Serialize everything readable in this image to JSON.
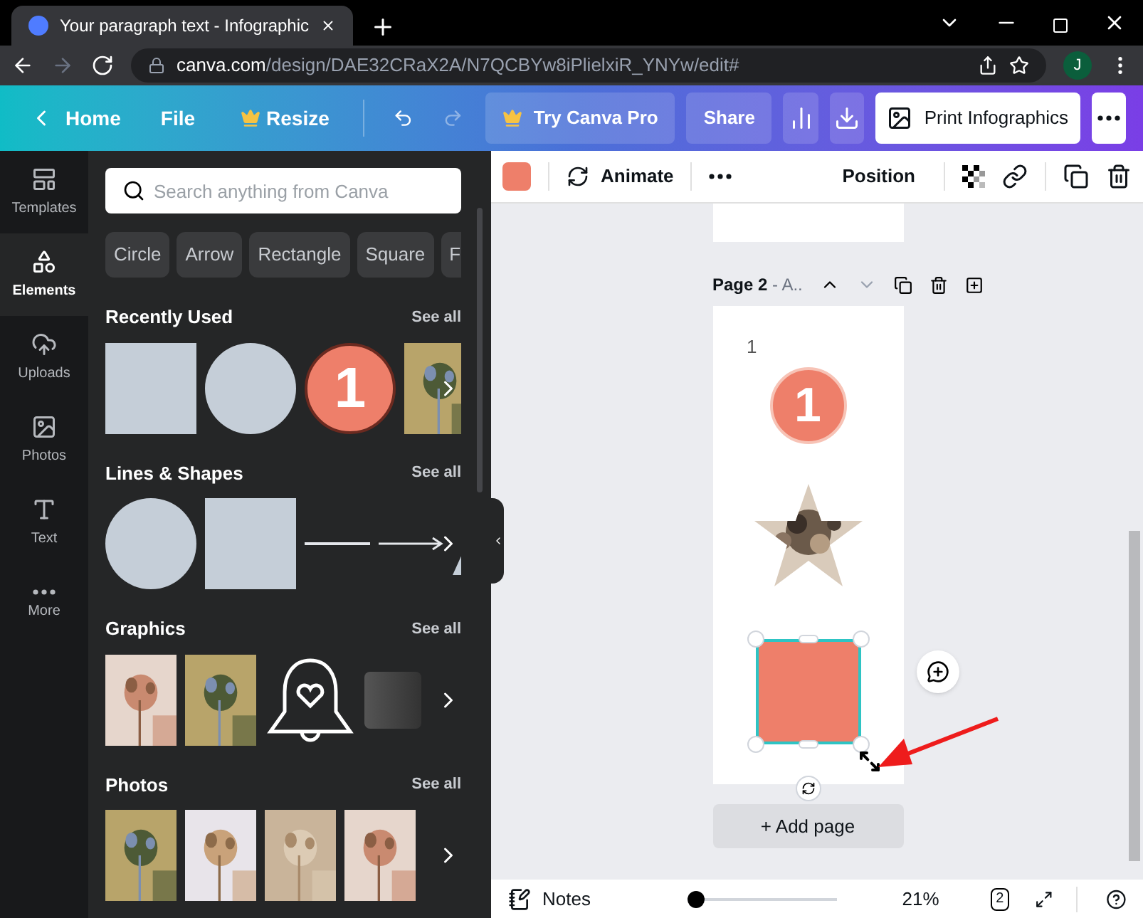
{
  "browser": {
    "tab_title": "Your paragraph text - Infographic",
    "url_host": "canva.com",
    "url_path": "/design/DAE32CRaX2A/N7QCBYw8iPlielxiR_YNYw/edit#",
    "profile_initial": "J"
  },
  "toolbar": {
    "home": "Home",
    "file": "File",
    "resize": "Resize",
    "try_pro": "Try Canva Pro",
    "share": "Share",
    "print": "Print Infographics"
  },
  "rail": [
    {
      "label": "Templates",
      "selected": false
    },
    {
      "label": "Elements",
      "selected": true
    },
    {
      "label": "Uploads",
      "selected": false
    },
    {
      "label": "Photos",
      "selected": false
    },
    {
      "label": "Text",
      "selected": false
    },
    {
      "label": "More",
      "selected": false
    }
  ],
  "search": {
    "placeholder": "Search anything from Canva"
  },
  "chips": [
    "Circle",
    "Arrow",
    "Rectangle",
    "Square",
    "F"
  ],
  "sections": [
    {
      "title": "Recently Used",
      "see_all": "See all",
      "items": [
        {
          "kind": "square"
        },
        {
          "kind": "circle"
        },
        {
          "kind": "badge",
          "text": "1"
        },
        {
          "kind": "picture"
        }
      ]
    },
    {
      "title": "Lines & Shapes",
      "see_all": "See all",
      "items": [
        {
          "kind": "circle"
        },
        {
          "kind": "square"
        },
        {
          "kind": "line"
        },
        {
          "kind": "arrow"
        },
        {
          "kind": "cone"
        }
      ]
    },
    {
      "title": "Graphics",
      "see_all": "See all",
      "items": [
        {
          "kind": "picture"
        },
        {
          "kind": "picture"
        },
        {
          "kind": "bell"
        },
        {
          "kind": "gray"
        }
      ]
    },
    {
      "title": "Photos",
      "see_all": "See all",
      "items": [
        {
          "kind": "picture"
        },
        {
          "kind": "picture"
        },
        {
          "kind": "picture"
        },
        {
          "kind": "picture"
        }
      ]
    }
  ],
  "edit_bar": {
    "color": "#ee7f6a",
    "animate": "Animate",
    "position": "Position"
  },
  "page": {
    "label": "Page 2",
    "suffix": "- A..",
    "number_text": "1",
    "badge_text": "1",
    "add_page": "+ Add page"
  },
  "bottom": {
    "notes": "Notes",
    "zoom": {
      "level": 0
    },
    "zoom_text": "21%",
    "page_count": "2"
  }
}
